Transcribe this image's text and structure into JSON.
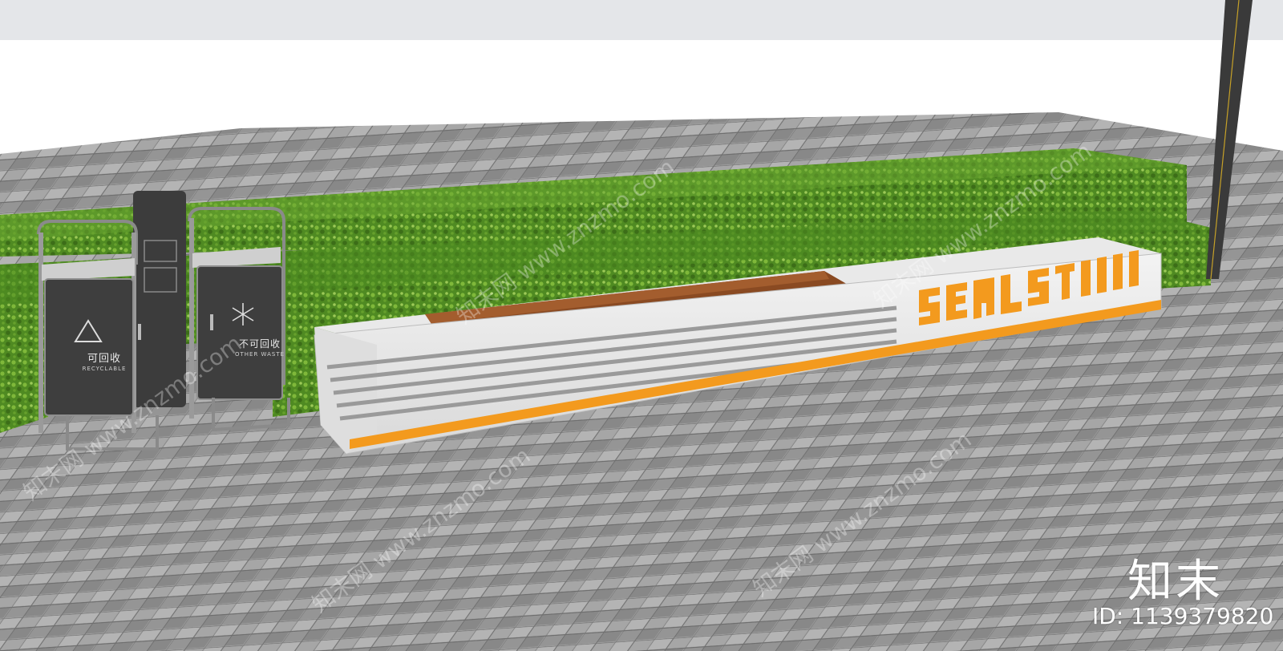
{
  "scene": {
    "bin_left": {
      "label_cn": "可回收",
      "label_en": "RECYCLABLE",
      "icon": "recycle-triangle-icon"
    },
    "bin_right": {
      "label_cn": "不可回收",
      "label_en": "OTHER WASTE",
      "icon": "other-waste-icon"
    },
    "bench_sign": {
      "text": "SEAT STOOL",
      "accent_color": "#f39a1e"
    },
    "colors": {
      "hedge": "#5e9a2c",
      "paving_light": "#a9a9a9",
      "paving_dark": "#7d7d7d",
      "bench_wood": "#8a4a22",
      "bench_stone": "#e6e6e6",
      "bin_body": "#3e3e3e"
    }
  },
  "watermark": {
    "logo": "知末",
    "id": "ID: 1139379820",
    "repeat_text": "知末网 www.znzmo.com"
  }
}
